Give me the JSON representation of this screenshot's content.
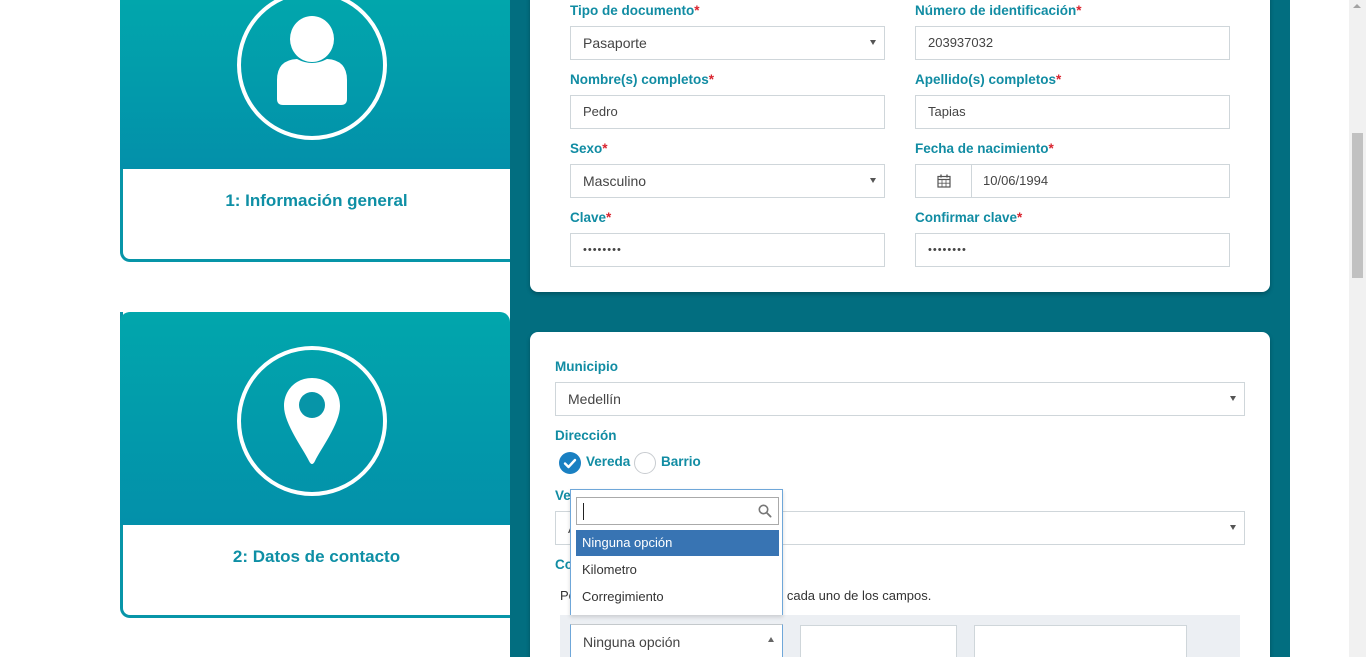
{
  "steps": [
    {
      "title": "1: Información general",
      "icon": "user-icon"
    },
    {
      "title": "2: Datos de contacto",
      "icon": "map-pin-icon"
    }
  ],
  "general_form": {
    "tipo_documento": {
      "label": "Tipo de documento",
      "required": "*",
      "value": "Pasaporte"
    },
    "numero_identificacion": {
      "label": "Número de identificación",
      "required": "*",
      "value": "203937032"
    },
    "nombres": {
      "label": "Nombre(s) completos",
      "required": "*",
      "value": "Pedro"
    },
    "apellidos": {
      "label": "Apellido(s) completos",
      "required": "*",
      "value": "Tapias"
    },
    "sexo": {
      "label": "Sexo",
      "required": "*",
      "value": "Masculino"
    },
    "fecha_nacimiento": {
      "label": "Fecha de nacimiento",
      "required": "*",
      "value": "10/06/1994",
      "icon": "calendar-icon"
    },
    "clave": {
      "label": "Clave",
      "required": "*",
      "value": "••••••••"
    },
    "confirmar_clave": {
      "label": "Confirmar clave",
      "required": "*",
      "value": "••••••••"
    }
  },
  "contact_form": {
    "municipio": {
      "label": "Municipio",
      "value": "Medellín"
    },
    "direccion": {
      "label": "Dirección",
      "options": [
        {
          "label": "Vereda",
          "checked": true
        },
        {
          "label": "Barrio",
          "checked": false
        }
      ]
    },
    "vereda_label_partial": "Ve",
    "vereda_value_partial": "A",
    "complemento_label_partial": "Co",
    "instructions_start": "Po",
    "instructions_end": "o cada uno de los campos.",
    "bottom_select_value": "Ninguna opción"
  },
  "dropdown": {
    "search_value": "",
    "search_icon": "search-icon",
    "options": [
      "Ninguna opción",
      "Kilometro",
      "Corregimiento"
    ],
    "selected": "Ninguna opción"
  },
  "colors": {
    "panel_teal": "#026e80",
    "label_teal": "#118ca3",
    "required_red": "#d9232e",
    "radio_blue": "#1a80c2",
    "dropdown_highlight": "#3874b3"
  }
}
